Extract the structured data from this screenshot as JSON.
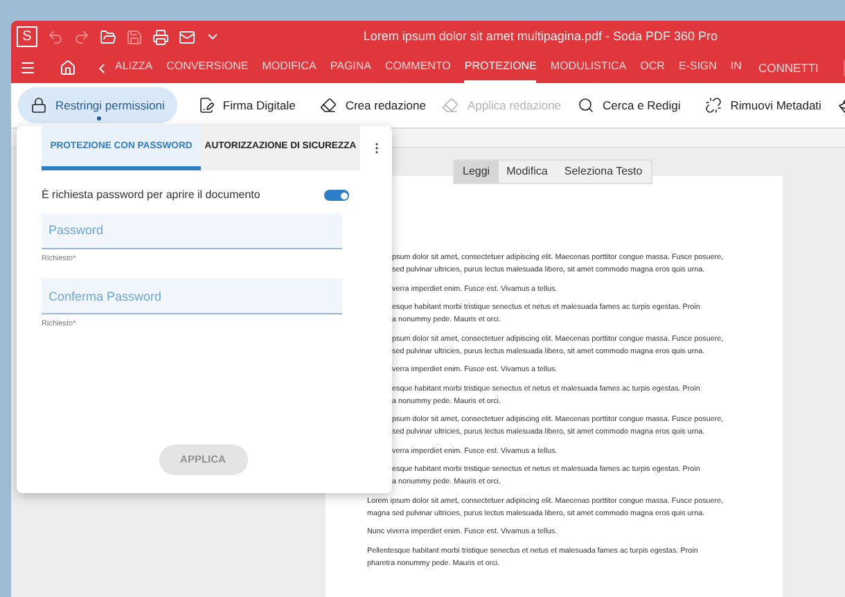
{
  "window": {
    "title": "Lorem ipsum dolor sit amet multipagina.pdf  -  Soda PDF 360 Pro",
    "logo": "S"
  },
  "ribbon_tabs": [
    {
      "label": "ALIZZA",
      "selected": false
    },
    {
      "label": "CONVERSIONE",
      "selected": false
    },
    {
      "label": "MODIFICA",
      "selected": false
    },
    {
      "label": "PAGINA",
      "selected": false
    },
    {
      "label": "COMMENTO",
      "selected": false
    },
    {
      "label": "PROTEZIONE",
      "selected": true
    },
    {
      "label": "MODULISTICA",
      "selected": false
    },
    {
      "label": "OCR",
      "selected": false
    },
    {
      "label": "E-SIGN",
      "selected": false
    },
    {
      "label": "IN",
      "selected": false
    }
  ],
  "connect": "CONNETTI",
  "toolbar": [
    {
      "kind": "lock",
      "label": "Restringi permissioni",
      "selected": true,
      "disabled": false
    },
    {
      "kind": "sign",
      "label": "Firma Digitale",
      "selected": false,
      "disabled": false
    },
    {
      "kind": "redact",
      "label": "Crea redazione",
      "selected": false,
      "disabled": false
    },
    {
      "kind": "apply",
      "label": "Applica redazione",
      "selected": false,
      "disabled": true
    },
    {
      "kind": "search",
      "label": "Cerca e Redigi",
      "selected": false,
      "disabled": false
    },
    {
      "kind": "unlink",
      "label": "Rimuovi Metadati",
      "selected": false,
      "disabled": false
    },
    {
      "kind": "clean",
      "selected": false,
      "disabled": false
    }
  ],
  "panel": {
    "tabs": [
      {
        "label": "PROTEZIONE CON PASSWORD",
        "selected": true
      },
      {
        "label": "AUTORIZZAZIONE DI SICUREZZA",
        "selected": false
      }
    ],
    "toggle": {
      "label": "È richiesta password per aprire il documento",
      "on": true
    },
    "fields": [
      {
        "placeholder": "Password",
        "helper": "Richiesto*"
      },
      {
        "placeholder": "Conferma Password",
        "helper": "Richiesto*"
      }
    ],
    "apply_button": {
      "label": "APPLICA",
      "disabled": true
    }
  },
  "view_modes": [
    {
      "label": "Leggi",
      "selected": true
    },
    {
      "label": "Modifica",
      "selected": false
    },
    {
      "label": "Seleziona Testo",
      "selected": false
    }
  ],
  "document": {
    "paragraphs": [
      {
        "kind": "clipped",
        "lines": [
          "psum dolor sit amet, consectetuer adipiscing elit. Maecenas porttitor congue massa. Fusce posuere,",
          "sed pulvinar ultricies, purus lectus malesuada libero, sit amet commodo magna eros quis urna."
        ]
      },
      {
        "kind": "clipped",
        "lines": [
          "verra imperdiet enim. Fusce est. Vivamus a tellus."
        ]
      },
      {
        "kind": "clipped",
        "lines": [
          "esque habitant morbi tristique senectus et netus et malesuada fames ac turpis egestas. Proin",
          "a nonummy pede. Mauris et orci."
        ]
      },
      {
        "kind": "clipped",
        "lines": [
          "psum dolor sit amet, consectetuer adipiscing elit. Maecenas porttitor congue massa. Fusce posuere,",
          "sed pulvinar ultricies, purus lectus malesuada libero, sit amet commodo magna eros quis urna."
        ]
      },
      {
        "kind": "clipped",
        "lines": [
          "verra imperdiet enim. Fusce est. Vivamus a tellus."
        ]
      },
      {
        "kind": "clipped",
        "lines": [
          "esque habitant morbi tristique senectus et netus et malesuada fames ac turpis egestas. Proin",
          "a nonummy pede. Mauris et orci."
        ]
      },
      {
        "kind": "clipped",
        "lines": [
          "psum dolor sit amet, consectetuer adipiscing elit. Maecenas porttitor congue massa. Fusce posuere,",
          "sed pulvinar ultricies, purus lectus malesuada libero, sit amet commodo magna eros quis urna."
        ]
      },
      {
        "kind": "clipped",
        "lines": [
          "verra imperdiet enim. Fusce est. Vivamus a tellus."
        ]
      },
      {
        "kind": "clipped",
        "lines": [
          "esque habitant morbi tristique senectus et netus et malesuada fames ac turpis egestas. Proin",
          "a nonummy pede. Mauris et orci."
        ]
      },
      {
        "kind": "full",
        "lines": [
          "Lorem ipsum dolor sit amet, consectetuer adipiscing elit. Maecenas porttitor congue massa. Fusce posuere,",
          "magna sed pulvinar ultricies, purus lectus malesuada libero, sit amet commodo magna eros quis urna."
        ]
      },
      {
        "kind": "full",
        "lines": [
          "Nunc viverra imperdiet enim. Fusce est. Vivamus a tellus."
        ]
      },
      {
        "kind": "full",
        "lines": [
          "Pellentesque habitant morbi tristique senectus et netus et malesuada fames ac turpis egestas. Proin",
          "pharetra nonummy pede. Mauris et orci."
        ]
      }
    ]
  }
}
